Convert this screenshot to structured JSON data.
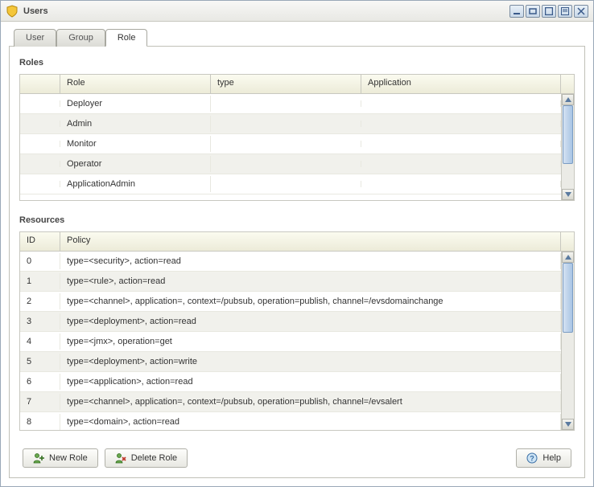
{
  "window": {
    "title": "Users"
  },
  "tabs": [
    {
      "label": "User",
      "active": false
    },
    {
      "label": "Group",
      "active": false
    },
    {
      "label": "Role",
      "active": true
    }
  ],
  "roles_section": {
    "label": "Roles",
    "columns": {
      "role": "Role",
      "type": "type",
      "application": "Application"
    },
    "rows": [
      {
        "role": "Deployer",
        "type": "",
        "application": ""
      },
      {
        "role": "Admin",
        "type": "",
        "application": ""
      },
      {
        "role": "Monitor",
        "type": "",
        "application": ""
      },
      {
        "role": "Operator",
        "type": "",
        "application": ""
      },
      {
        "role": "ApplicationAdmin",
        "type": "",
        "application": ""
      }
    ]
  },
  "resources_section": {
    "label": "Resources",
    "columns": {
      "id": "ID",
      "policy": "Policy"
    },
    "rows": [
      {
        "id": "0",
        "policy": "type=<security>, action=read"
      },
      {
        "id": "1",
        "policy": "type=<rule>, action=read"
      },
      {
        "id": "2",
        "policy": "type=<channel>, application=, context=/pubsub, operation=publish, channel=/evsdomainchange"
      },
      {
        "id": "3",
        "policy": "type=<deployment>, action=read"
      },
      {
        "id": "4",
        "policy": "type=<jmx>, operation=get"
      },
      {
        "id": "5",
        "policy": "type=<deployment>, action=write"
      },
      {
        "id": "6",
        "policy": "type=<application>, action=read"
      },
      {
        "id": "7",
        "policy": "type=<channel>, application=, context=/pubsub, operation=publish, channel=/evsalert"
      },
      {
        "id": "8",
        "policy": "type=<domain>, action=read"
      }
    ]
  },
  "buttons": {
    "new_role": "New Role",
    "delete_role": "Delete Role",
    "help": "Help"
  }
}
